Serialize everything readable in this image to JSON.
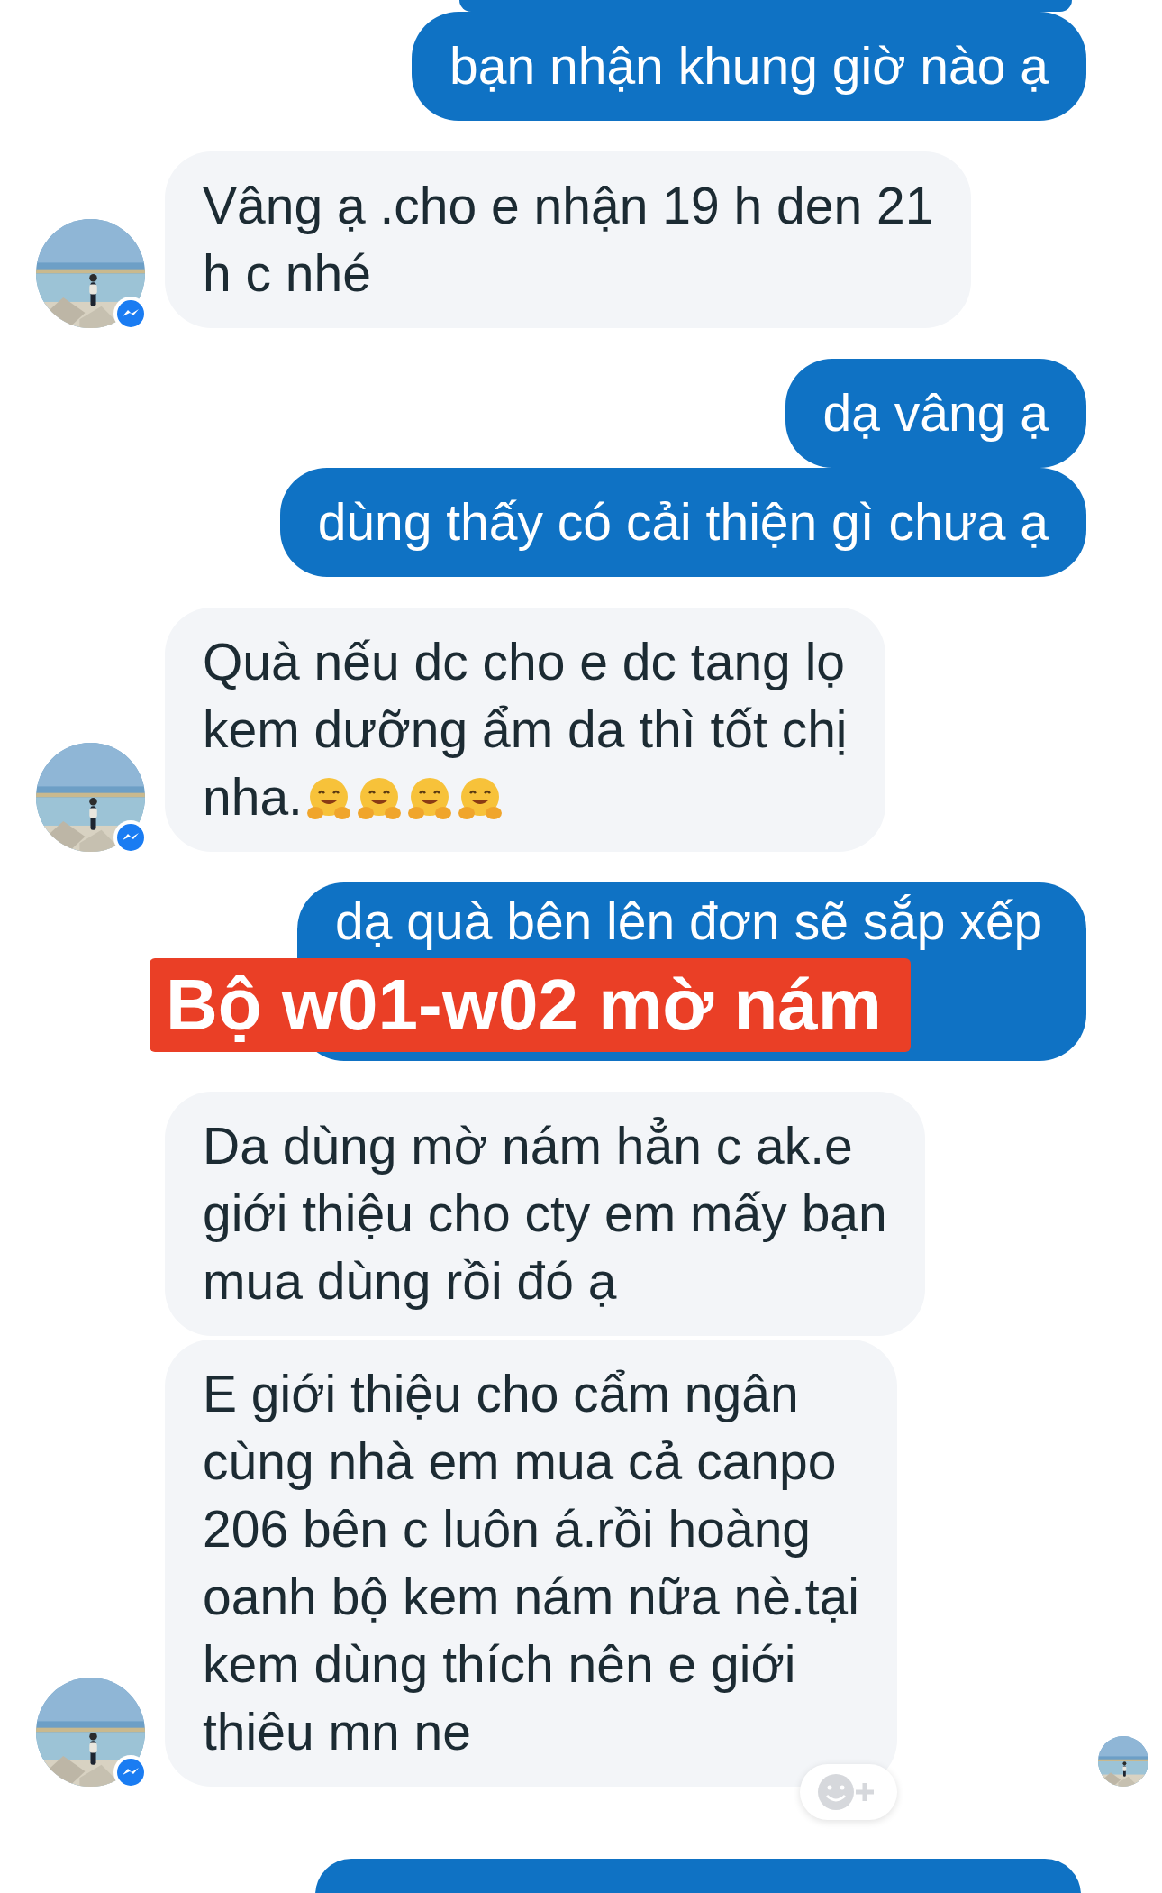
{
  "messages": [
    {
      "kind": "outgoing_cut"
    },
    {
      "kind": "outgoing",
      "lines": [
        "bạn nhận khung giờ nào ạ"
      ]
    },
    {
      "kind": "incoming",
      "lines": [
        "Vâng ạ .cho e nhận 19 h den 21",
        "h c nhé"
      ],
      "show_avatar": true
    },
    {
      "kind": "outgoing",
      "lines": [
        "dạ vâng ạ"
      ]
    },
    {
      "kind": "outgoing",
      "lines": [
        "dùng thấy có cải thiện gì chưa ạ"
      ]
    },
    {
      "kind": "incoming",
      "lines": [
        "Quà nếu dc cho e dc tang lọ",
        "kem  dưỡng ẩm da thì tốt chị",
        "nha."
      ],
      "ends_with_emoji": true,
      "show_avatar": true
    },
    {
      "kind": "outgoing",
      "lines": [
        "dạ quà bên lên đơn sẽ sắp xếp"
      ],
      "overlay_label": "Bộ w01-w02 mờ nám"
    },
    {
      "kind": "incoming",
      "lines": [
        "Da dùng mờ nám hẳn c ak.e",
        "giới thiệu cho cty em mấy bạn",
        "mua dùng rồi đó ạ"
      ],
      "show_avatar": false
    },
    {
      "kind": "incoming",
      "lines": [
        "E giới thiệu cho cẩm ngân",
        "cùng nhà em mua cả canpo",
        "206 bên c luôn á.rồi hoàng",
        "oanh  bộ kem nám nữa nè.tại",
        "kem dùng thích nên e giới",
        "thiêu mn ne"
      ],
      "show_avatar": true,
      "reaction_button": true,
      "seen": true
    },
    {
      "kind": "outgoing_cut"
    }
  ]
}
